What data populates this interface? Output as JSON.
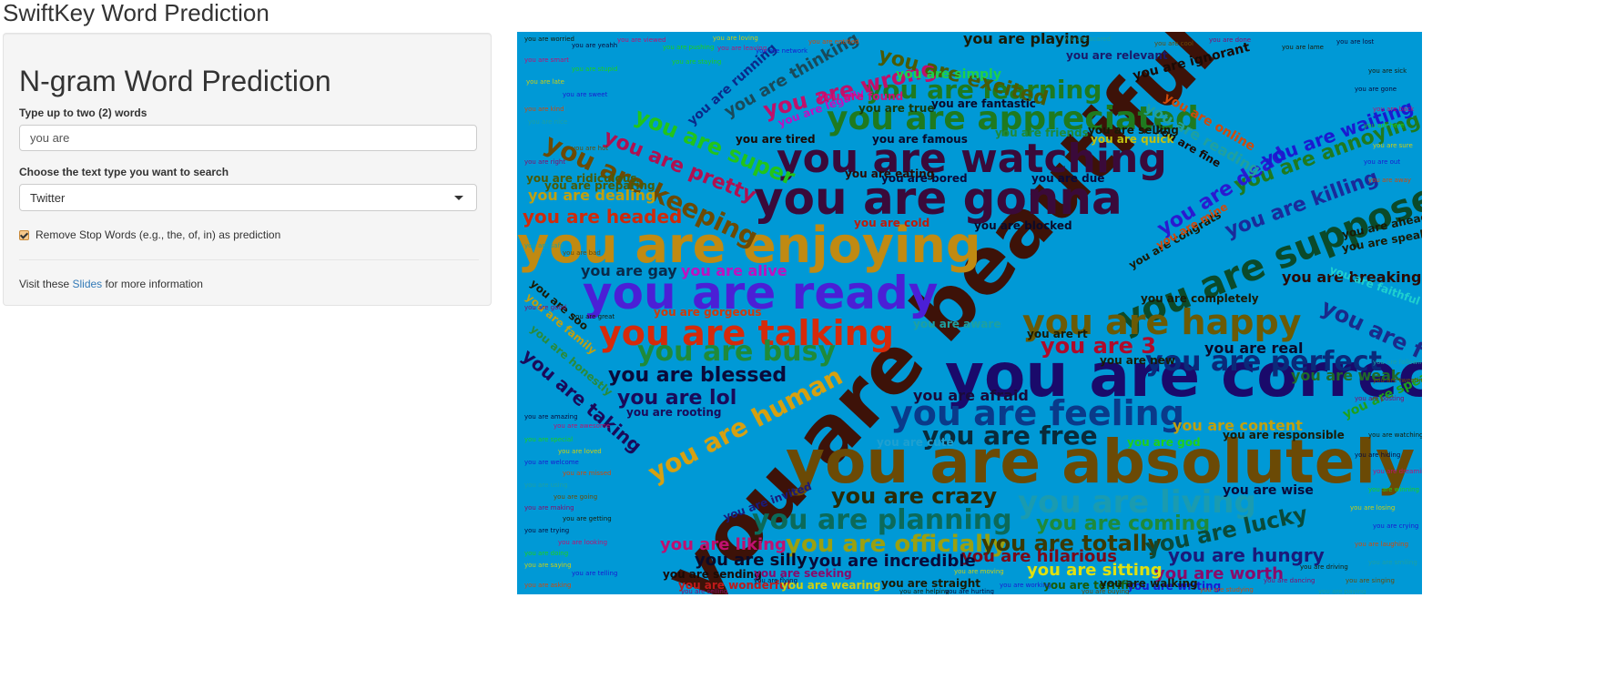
{
  "app": {
    "title": "SwiftKey Word Prediction"
  },
  "sidebar": {
    "heading": "N-gram Word Prediction",
    "input_label": "Type up to two (2) words",
    "input_value": "you are",
    "select_label": "Choose the text type you want to search",
    "select_value": "Twitter",
    "checkbox_label": "Remove Stop Words (e.g., the, of, in) as prediction",
    "checkbox_checked": true,
    "footer_prefix": "Visit these",
    "footer_link": "Slides",
    "footer_suffix": "for more information"
  },
  "cloud": {
    "background": "#0099d6",
    "words": [
      {
        "text": "you are beautiful",
        "color": "#3d1208"
      },
      {
        "text": "you are absolutely",
        "color": "#6b4a05"
      },
      {
        "text": "you are correct",
        "color": "#1a0a6b"
      },
      {
        "text": "you are enjoying",
        "color": "#c08a12"
      },
      {
        "text": "you are gonna",
        "color": "#3a0a3a"
      },
      {
        "text": "you are watching",
        "color": "#3a0a3a"
      },
      {
        "text": "you are ready",
        "color": "#4b1fd6"
      },
      {
        "text": "you are supposed",
        "color": "#0b4a2a"
      },
      {
        "text": "you are appreciated",
        "color": "#1f7a1f"
      },
      {
        "text": "you are happy",
        "color": "#6b5a05"
      },
      {
        "text": "you are talking",
        "color": "#d62a0a"
      },
      {
        "text": "you are feeling",
        "color": "#0a3a8a"
      },
      {
        "text": "you are living",
        "color": "#1a9bb0"
      },
      {
        "text": "you are planning",
        "color": "#0b6a5a"
      },
      {
        "text": "you are learning",
        "color": "#1f7a1f"
      },
      {
        "text": "you are keeping",
        "color": "#6b4a05"
      },
      {
        "text": "you are busy",
        "color": "#1f8a3a"
      },
      {
        "text": "you are perfect",
        "color": "#0a2a7a"
      },
      {
        "text": "you are human",
        "color": "#d6a010"
      },
      {
        "text": "you are pretty",
        "color": "#b01050"
      },
      {
        "text": "you are super",
        "color": "#22c41a"
      },
      {
        "text": "you are wrong",
        "color": "#c0106a"
      },
      {
        "text": "you are excited",
        "color": "#4a5a05"
      },
      {
        "text": "you are free",
        "color": "#0a2a3a"
      },
      {
        "text": "you are crazy",
        "color": "#2a2a05"
      },
      {
        "text": "you are officially",
        "color": "#9aa010"
      },
      {
        "text": "you are coming",
        "color": "#1f8a3a"
      },
      {
        "text": "you are totally",
        "color": "#3a3a05"
      },
      {
        "text": "you are lucky",
        "color": "#0a4a3a"
      },
      {
        "text": "you are funny",
        "color": "#1a2a8a"
      },
      {
        "text": "you are blessed",
        "color": "#0a0a3a"
      },
      {
        "text": "you are lol",
        "color": "#1a0a5a"
      },
      {
        "text": "you are 3",
        "color": "#b00a2a"
      },
      {
        "text": "you are taking",
        "color": "#1a0a5a"
      },
      {
        "text": "you are killing",
        "color": "#1a2a9a"
      },
      {
        "text": "you are annoying",
        "color": "#1f7a1f"
      },
      {
        "text": "you are dead",
        "color": "#2a1ad0"
      },
      {
        "text": "you are waiting",
        "color": "#1a1ad0"
      },
      {
        "text": "you are hungry",
        "color": "#1a1a7a"
      },
      {
        "text": "you are worth",
        "color": "#8a0a6a"
      },
      {
        "text": "you are sitting",
        "color": "#e0e010"
      },
      {
        "text": "you are hilarious",
        "color": "#7a0a1a"
      },
      {
        "text": "you are silly",
        "color": "#0a0a2a"
      },
      {
        "text": "you are incredible",
        "color": "#0a0a3a"
      },
      {
        "text": "you are liking",
        "color": "#c01070"
      },
      {
        "text": "you are headed",
        "color": "#d02a0a"
      },
      {
        "text": "you are dealing",
        "color": "#c0a010"
      },
      {
        "text": "you are playing",
        "color": "#1a1a05"
      },
      {
        "text": "you are thinking",
        "color": "#1a4a5a"
      },
      {
        "text": "you are running",
        "color": "#0a2a8a"
      },
      {
        "text": "you are afraid",
        "color": "#1a0a3a"
      },
      {
        "text": "you are content",
        "color": "#c0a010"
      },
      {
        "text": "you are real",
        "color": "#0a0a2a"
      },
      {
        "text": "you are weak",
        "color": "#1f6a2a"
      },
      {
        "text": "you are breaking",
        "color": "#2a0a05"
      },
      {
        "text": "you are wise",
        "color": "#0a0a3a"
      },
      {
        "text": "you are alive",
        "color": "#c010c0"
      },
      {
        "text": "you are gay",
        "color": "#0a2a4a"
      },
      {
        "text": "you are gorgeous",
        "color": "#d03a0a"
      },
      {
        "text": "you are rooting",
        "color": "#1a0a5a"
      },
      {
        "text": "you are tired",
        "color": "#1a0a05"
      },
      {
        "text": "you are famous",
        "color": "#0a0a2a"
      },
      {
        "text": "you are fantastic",
        "color": "#0a0a2a"
      },
      {
        "text": "you are bored",
        "color": "#0a0a3a"
      },
      {
        "text": "you are due",
        "color": "#0a0a3a"
      },
      {
        "text": "you are eating",
        "color": "#2a0a05"
      },
      {
        "text": "you are cold",
        "color": "#c01a0a"
      },
      {
        "text": "you are blocked",
        "color": "#0a0a2a"
      },
      {
        "text": "you are relevant",
        "color": "#1a1a6a"
      },
      {
        "text": "you are ignorant",
        "color": "#1a0a05"
      },
      {
        "text": "you are reading",
        "color": "#1fa0a0"
      },
      {
        "text": "you are online",
        "color": "#d04a0a"
      },
      {
        "text": "you are fine",
        "color": "#1a0a05"
      },
      {
        "text": "you are quick",
        "color": "#c0c010"
      },
      {
        "text": "you are selling",
        "color": "#1a1a05"
      },
      {
        "text": "you are ridiculous",
        "color": "#4a5a05"
      },
      {
        "text": "you are preparing",
        "color": "#4a5a05"
      },
      {
        "text": "you are legally",
        "color": "#c010c0"
      },
      {
        "text": "you are true",
        "color": "#1a3a05"
      },
      {
        "text": "you are friends",
        "color": "#1f8a3a"
      },
      {
        "text": "you are completely",
        "color": "#1a1a05"
      },
      {
        "text": "you are faithful",
        "color": "#1fd0d0"
      },
      {
        "text": "you are speaks",
        "color": "#1a1a05"
      },
      {
        "text": "you are ahead",
        "color": "#1a1a05"
      },
      {
        "text": "you are responsible",
        "color": "#1a1a05"
      },
      {
        "text": "you are speaking",
        "color": "#1fa01a"
      },
      {
        "text": "you are invited",
        "color": "#1a1a7a"
      },
      {
        "text": "you are sending",
        "color": "#1a0a05"
      },
      {
        "text": "you are wonderful",
        "color": "#c01a1a"
      },
      {
        "text": "you are wearing",
        "color": "#d0d010"
      },
      {
        "text": "you are seeking",
        "color": "#8a0a6a"
      },
      {
        "text": "you are straight",
        "color": "#1a1a05"
      },
      {
        "text": "you are terrific",
        "color": "#1a5a05"
      },
      {
        "text": "you are writing",
        "color": "#1a1ad0"
      },
      {
        "text": "you are walking",
        "color": "#1a1a05"
      },
      {
        "text": "you are god",
        "color": "#1fd01a"
      },
      {
        "text": "you are soo",
        "color": "#1a1a05"
      },
      {
        "text": "you are family",
        "color": "#c0a010"
      },
      {
        "text": "you are honestly",
        "color": "#2a8a3a"
      },
      {
        "text": "you are simply",
        "color": "#1fd04a"
      },
      {
        "text": "you are found",
        "color": "#d0107a"
      },
      {
        "text": "you are aware",
        "color": "#1fa0a0"
      },
      {
        "text": "you are rt",
        "color": "#1a1a05"
      },
      {
        "text": "you are congrats",
        "color": "#1a1a05"
      },
      {
        "text": "you are new",
        "color": "#1a1a05"
      },
      {
        "text": "you are mine",
        "color": "#d04a0a"
      },
      {
        "text": "you are cute",
        "color": "#1fa0d0"
      }
    ],
    "tiny_words": [
      "you are worried",
      "you are yeahh",
      "you are viewed",
      "you are pushing",
      "you are loving",
      "you are network",
      "you are entitled",
      "you are scared",
      "you are cool",
      "you are done",
      "you are lame",
      "you are lost",
      "you are smart",
      "you are stupid",
      "you are late",
      "you are sweet",
      "you are kind",
      "you are nice",
      "you are hot",
      "you are right",
      "you are sick",
      "you are gone",
      "you are back",
      "you are here",
      "you are sure",
      "you are out",
      "you are away",
      "you are safe",
      "you are bad",
      "you are good",
      "you are great",
      "you are amazing",
      "you are awesome",
      "you are special",
      "you are loved",
      "you are welcome",
      "you are missed",
      "you are using",
      "you are going",
      "you are making",
      "you are getting",
      "you are trying",
      "you are looking",
      "you are doing",
      "you are saying",
      "you are telling",
      "you are asking",
      "you are following",
      "you are tweeting",
      "you are posting",
      "you are watching",
      "you are hiding",
      "you are dreaming",
      "you are winning",
      "you are losing",
      "you are crying",
      "you are laughing",
      "you are smiling",
      "you are singing",
      "you are dancing",
      "you are driving",
      "you are flying",
      "you are leaving",
      "you are staying",
      "you are moving",
      "you are working",
      "you are studying",
      "you are paying",
      "you are buying",
      "you are selling",
      "you are helping",
      "you are hurting"
    ]
  }
}
